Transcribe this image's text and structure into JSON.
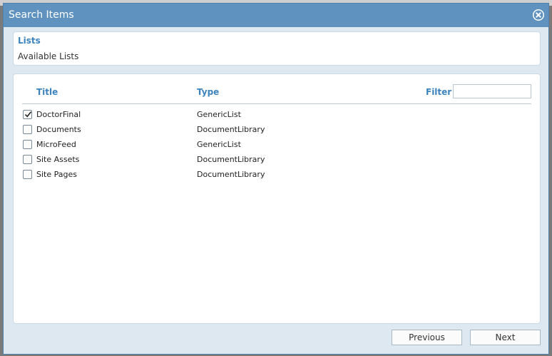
{
  "dialog": {
    "title": "Search Items",
    "close_icon": "close-circle-icon"
  },
  "lists_section": {
    "heading": "Lists",
    "subtitle": "Available Lists"
  },
  "table": {
    "columns": {
      "title": "Title",
      "type": "Type"
    },
    "filter_label": "Filter",
    "filter_value": "",
    "rows": [
      {
        "title": "DoctorFinal",
        "type": "GenericList",
        "checked": true
      },
      {
        "title": "Documents",
        "type": "DocumentLibrary",
        "checked": false
      },
      {
        "title": "MicroFeed",
        "type": "GenericList",
        "checked": false
      },
      {
        "title": "Site Assets",
        "type": "DocumentLibrary",
        "checked": false
      },
      {
        "title": "Site Pages",
        "type": "DocumentLibrary",
        "checked": false
      }
    ]
  },
  "buttons": {
    "previous": "Previous",
    "next": "Next"
  }
}
